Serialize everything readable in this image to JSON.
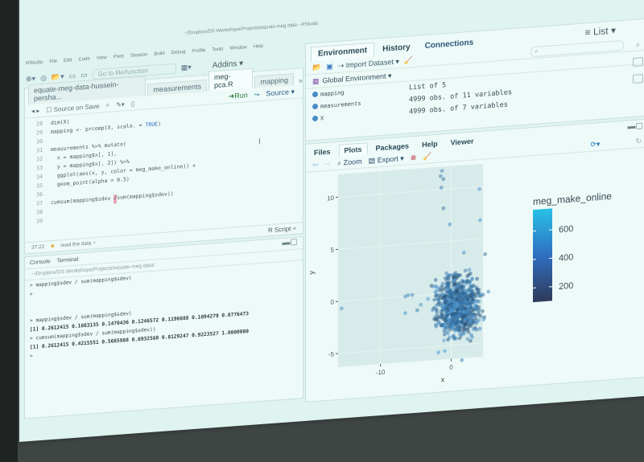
{
  "app": {
    "name": "RStudio",
    "window_title_path": "~/Dropbox/DS Workshops/Projects/equate-meg data - RStudio",
    "dock_badge": "equate-meg",
    "menubar": [
      "RStudio",
      "File",
      "Edit",
      "Code",
      "View",
      "Plots",
      "Session",
      "Build",
      "Debug",
      "Profile",
      "Tools",
      "Window",
      "Help"
    ]
  },
  "toolbar": {
    "goto_placeholder": "Go to file/function",
    "addins_label": "Addins ▾"
  },
  "source": {
    "tabs": [
      {
        "label": "equate-meg-data-hussein-persha..."
      },
      {
        "label": "measurements"
      },
      {
        "label": "meg-pca.R"
      },
      {
        "label": "mapping"
      }
    ],
    "active_tab": "meg-pca.R",
    "source_on_save": "Source on Save",
    "run_label": "Run",
    "source_label": "Source ▾",
    "lines": [
      {
        "n": "28",
        "code": "dim(X)"
      },
      {
        "n": "29",
        "code": "mapping <- prcomp(X, scale. = ",
        "kw": "TRUE",
        "tail": ")"
      },
      {
        "n": "30",
        "code": ""
      },
      {
        "n": "31",
        "code": "measurements %>% mutate("
      },
      {
        "n": "32",
        "code": "  x = mapping$x[, 1],"
      },
      {
        "n": "33",
        "code": "  y = mapping$x[, 2]) %>%"
      },
      {
        "n": "34",
        "code": "  ggplot(aes(x, y, color = meg_make_online)) +"
      },
      {
        "n": "35",
        "code": "  geom_point(alpha = 0.5)"
      },
      {
        "n": "36",
        "code": ""
      },
      {
        "n": "37",
        "code": "cumsum(mapping$sdev ",
        "cursor": "/",
        "tail": "sum(mapping$sdev))"
      },
      {
        "n": "38",
        "code": ""
      },
      {
        "n": "39",
        "code": ""
      }
    ],
    "status_position": "37:22",
    "status_section": "read the data ÷",
    "file_type": "R Script ÷"
  },
  "console": {
    "tabs": [
      "Console",
      "Terminal"
    ],
    "path": "~/Dropbox/DS Workshops/Projects/equate-meg data/",
    "lines": [
      {
        "type": "in",
        "text": "> mapping$sdev / sum(mapping$sdev("
      },
      {
        "type": "in",
        "text": "+"
      },
      {
        "type": "in",
        "text": ""
      },
      {
        "type": "in",
        "text": ""
      },
      {
        "type": "in",
        "text": "> mapping$sdev / sum(mapping$sdev)"
      },
      {
        "type": "out",
        "text": "[1] 0.2612415 0.1603135 0.1470436 0.1246572 0.1196688 0.1094279 0.0776473"
      },
      {
        "type": "in",
        "text": "> cumsum(mapping$sdev / sum(mapping$sdev))"
      },
      {
        "type": "out",
        "text": "[1] 0.2612415 0.4215551 0.5685988 0.6932560 0.8129247 0.9223527 1.0000000"
      },
      {
        "type": "in",
        "text": ">"
      }
    ]
  },
  "environment": {
    "tabs": [
      "Environment",
      "History",
      "Connections"
    ],
    "active_tab": "Environment",
    "view_mode": "List ▾",
    "import_dataset": "Import Dataset ▾",
    "scope": "Global Environment ▾",
    "variables": [
      {
        "name": "mapping",
        "value": "List of 5"
      },
      {
        "name": "measurements",
        "value": "4999 obs. of 11 variables"
      },
      {
        "name": "X",
        "value": "4999 obs. of 7 variables"
      }
    ]
  },
  "plots_pane": {
    "tabs": [
      "Files",
      "Plots",
      "Packages",
      "Help",
      "Viewer"
    ],
    "active_tab": "Plots",
    "zoom_label": "Zoom",
    "export_label": "Export ▾"
  },
  "chart_data": {
    "type": "scatter",
    "title": "",
    "xlabel": "x",
    "ylabel": "y",
    "x_ticks": [
      "-10",
      "0"
    ],
    "x_tick_values": [
      -10,
      0
    ],
    "y_ticks": [
      "-5",
      "0",
      "5",
      "10"
    ],
    "y_tick_values": [
      -5,
      0,
      5,
      10
    ],
    "xlim": [
      -16,
      4.5
    ],
    "ylim": [
      -6.3,
      12.2
    ],
    "grid": true,
    "alpha": 0.5,
    "legend": {
      "title": "meg_make_online",
      "type": "continuous",
      "ticks": [
        "200",
        "400",
        "600"
      ],
      "tick_values": [
        200,
        400,
        600
      ],
      "range": [
        100,
        750
      ],
      "colors": [
        "#132b43",
        "#56b1f7"
      ],
      "position": "right"
    },
    "outlier_points": [
      {
        "x": -1.3,
        "y": 11.8,
        "c": 520
      },
      {
        "x": -1.5,
        "y": 11.3,
        "c": 480
      },
      {
        "x": -1.1,
        "y": 11.0,
        "c": 450
      },
      {
        "x": -1.4,
        "y": 10.2,
        "c": 500
      },
      {
        "x": -1.1,
        "y": 8.2,
        "c": 420
      },
      {
        "x": -0.2,
        "y": 6.6,
        "c": 560
      },
      {
        "x": 4.0,
        "y": 9.8,
        "c": 600
      },
      {
        "x": 4.1,
        "y": 6.8,
        "c": 620
      },
      {
        "x": -15.5,
        "y": -0.7,
        "c": 610
      },
      {
        "x": -6.5,
        "y": 0.0,
        "c": 550
      },
      {
        "x": -6.1,
        "y": 0.1,
        "c": 500
      },
      {
        "x": -5.5,
        "y": 0.1,
        "c": 520
      },
      {
        "x": -6.5,
        "y": -1.6,
        "c": 600
      },
      {
        "x": -4.8,
        "y": -1.4,
        "c": 480
      },
      {
        "x": -4.3,
        "y": -0.9,
        "c": 590
      },
      {
        "x": -1.8,
        "y": -5.6,
        "c": 620
      },
      {
        "x": -0.9,
        "y": -5.5,
        "c": 650
      },
      {
        "x": 1.5,
        "y": -6.5,
        "c": 500
      },
      {
        "x": 1.8,
        "y": 3.8,
        "c": 560
      },
      {
        "x": 4.8,
        "y": 3.5,
        "c": 420
      }
    ],
    "cluster": {
      "x_range": [
        -3,
        6
      ],
      "y_range": [
        -5,
        3
      ],
      "count": 4999,
      "center": [
        1.0,
        -1.2
      ]
    }
  }
}
